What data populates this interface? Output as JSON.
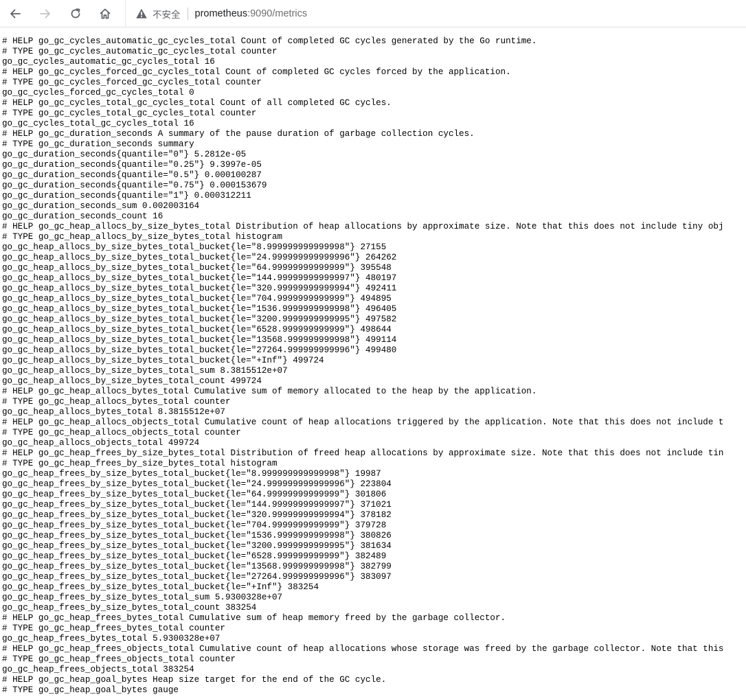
{
  "browser": {
    "security_label": "不安全",
    "url_host": "prometheus",
    "url_rest": ":9090/metrics"
  },
  "metrics_lines": [
    "# HELP go_gc_cycles_automatic_gc_cycles_total Count of completed GC cycles generated by the Go runtime.",
    "# TYPE go_gc_cycles_automatic_gc_cycles_total counter",
    "go_gc_cycles_automatic_gc_cycles_total 16",
    "# HELP go_gc_cycles_forced_gc_cycles_total Count of completed GC cycles forced by the application.",
    "# TYPE go_gc_cycles_forced_gc_cycles_total counter",
    "go_gc_cycles_forced_gc_cycles_total 0",
    "# HELP go_gc_cycles_total_gc_cycles_total Count of all completed GC cycles.",
    "# TYPE go_gc_cycles_total_gc_cycles_total counter",
    "go_gc_cycles_total_gc_cycles_total 16",
    "# HELP go_gc_duration_seconds A summary of the pause duration of garbage collection cycles.",
    "# TYPE go_gc_duration_seconds summary",
    "go_gc_duration_seconds{quantile=\"0\"} 5.2812e-05",
    "go_gc_duration_seconds{quantile=\"0.25\"} 9.3997e-05",
    "go_gc_duration_seconds{quantile=\"0.5\"} 0.000100287",
    "go_gc_duration_seconds{quantile=\"0.75\"} 0.000153679",
    "go_gc_duration_seconds{quantile=\"1\"} 0.000312211",
    "go_gc_duration_seconds_sum 0.002003164",
    "go_gc_duration_seconds_count 16",
    "# HELP go_gc_heap_allocs_by_size_bytes_total Distribution of heap allocations by approximate size. Note that this does not include tiny obj",
    "# TYPE go_gc_heap_allocs_by_size_bytes_total histogram",
    "go_gc_heap_allocs_by_size_bytes_total_bucket{le=\"8.999999999999998\"} 27155",
    "go_gc_heap_allocs_by_size_bytes_total_bucket{le=\"24.999999999999996\"} 264262",
    "go_gc_heap_allocs_by_size_bytes_total_bucket{le=\"64.99999999999999\"} 395548",
    "go_gc_heap_allocs_by_size_bytes_total_bucket{le=\"144.99999999999997\"} 480197",
    "go_gc_heap_allocs_by_size_bytes_total_bucket{le=\"320.99999999999994\"} 492411",
    "go_gc_heap_allocs_by_size_bytes_total_bucket{le=\"704.9999999999999\"} 494895",
    "go_gc_heap_allocs_by_size_bytes_total_bucket{le=\"1536.9999999999998\"} 496405",
    "go_gc_heap_allocs_by_size_bytes_total_bucket{le=\"3200.9999999999995\"} 497582",
    "go_gc_heap_allocs_by_size_bytes_total_bucket{le=\"6528.999999999999\"} 498644",
    "go_gc_heap_allocs_by_size_bytes_total_bucket{le=\"13568.999999999998\"} 499114",
    "go_gc_heap_allocs_by_size_bytes_total_bucket{le=\"27264.999999999996\"} 499480",
    "go_gc_heap_allocs_by_size_bytes_total_bucket{le=\"+Inf\"} 499724",
    "go_gc_heap_allocs_by_size_bytes_total_sum 8.3815512e+07",
    "go_gc_heap_allocs_by_size_bytes_total_count 499724",
    "# HELP go_gc_heap_allocs_bytes_total Cumulative sum of memory allocated to the heap by the application.",
    "# TYPE go_gc_heap_allocs_bytes_total counter",
    "go_gc_heap_allocs_bytes_total 8.3815512e+07",
    "# HELP go_gc_heap_allocs_objects_total Cumulative count of heap allocations triggered by the application. Note that this does not include t",
    "# TYPE go_gc_heap_allocs_objects_total counter",
    "go_gc_heap_allocs_objects_total 499724",
    "# HELP go_gc_heap_frees_by_size_bytes_total Distribution of freed heap allocations by approximate size. Note that this does not include tin",
    "# TYPE go_gc_heap_frees_by_size_bytes_total histogram",
    "go_gc_heap_frees_by_size_bytes_total_bucket{le=\"8.999999999999998\"} 19987",
    "go_gc_heap_frees_by_size_bytes_total_bucket{le=\"24.999999999999996\"} 223804",
    "go_gc_heap_frees_by_size_bytes_total_bucket{le=\"64.99999999999999\"} 301806",
    "go_gc_heap_frees_by_size_bytes_total_bucket{le=\"144.99999999999997\"} 371021",
    "go_gc_heap_frees_by_size_bytes_total_bucket{le=\"320.99999999999994\"} 378182",
    "go_gc_heap_frees_by_size_bytes_total_bucket{le=\"704.9999999999999\"} 379728",
    "go_gc_heap_frees_by_size_bytes_total_bucket{le=\"1536.9999999999998\"} 380826",
    "go_gc_heap_frees_by_size_bytes_total_bucket{le=\"3200.9999999999995\"} 381634",
    "go_gc_heap_frees_by_size_bytes_total_bucket{le=\"6528.999999999999\"} 382489",
    "go_gc_heap_frees_by_size_bytes_total_bucket{le=\"13568.999999999998\"} 382799",
    "go_gc_heap_frees_by_size_bytes_total_bucket{le=\"27264.999999999996\"} 383097",
    "go_gc_heap_frees_by_size_bytes_total_bucket{le=\"+Inf\"} 383254",
    "go_gc_heap_frees_by_size_bytes_total_sum 5.9300328e+07",
    "go_gc_heap_frees_by_size_bytes_total_count 383254",
    "# HELP go_gc_heap_frees_bytes_total Cumulative sum of heap memory freed by the garbage collector.",
    "# TYPE go_gc_heap_frees_bytes_total counter",
    "go_gc_heap_frees_bytes_total 5.9300328e+07",
    "# HELP go_gc_heap_frees_objects_total Cumulative count of heap allocations whose storage was freed by the garbage collector. Note that this",
    "# TYPE go_gc_heap_frees_objects_total counter",
    "go_gc_heap_frees_objects_total 383254",
    "# HELP go_gc_heap_goal_bytes Heap size target for the end of the GC cycle.",
    "# TYPE go_gc_heap_goal_bytes gauge"
  ]
}
